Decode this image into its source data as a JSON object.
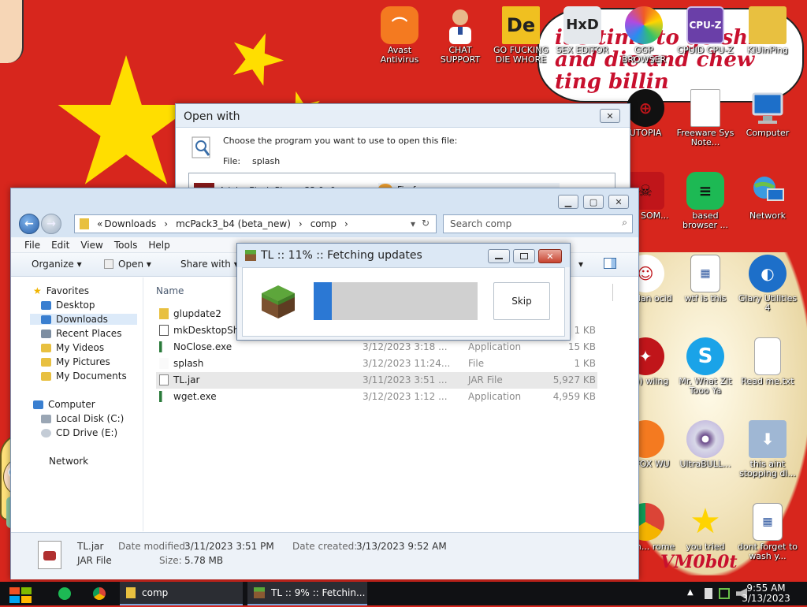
{
  "desktop": {
    "speech_text": "it's time to go shi and die and chew ting billin",
    "watermark": "VM0b0t",
    "icons": [
      {
        "name": "avast",
        "label": "Avast Antivirus",
        "color": "#f47a20"
      },
      {
        "name": "chat",
        "label": "CHAT SUPPORT",
        "color": "#d9b38c"
      },
      {
        "name": "de",
        "label": "GO FUCKING DIE WHORE",
        "color": "#f0c020"
      },
      {
        "name": "hxd",
        "label": "SEX EDITOR",
        "color": "#d0d8e0"
      },
      {
        "name": "browser",
        "label": "GGP BROWSER",
        "color": "#f05a28"
      },
      {
        "name": "cpuz",
        "label": "CPUID CPU-Z",
        "color": "#6a3fa8"
      },
      {
        "name": "kiuinping",
        "label": "KiUinPing",
        "color": "#e8c040"
      },
      {
        "name": "utopia",
        "label": "UTOPIA",
        "color": "#111111"
      },
      {
        "name": "freeware",
        "label": "Freeware Sys Note...",
        "color": "#ffffff"
      },
      {
        "name": "computer",
        "label": "Computer",
        "color": "#3a8fd8"
      },
      {
        "name": "tya",
        "label": "TYA SOM...",
        "color": "#c0151a"
      },
      {
        "name": "based",
        "label": "based browser ...",
        "color": "#1db954"
      },
      {
        "name": "network",
        "label": "Network",
        "color": "#3a8fd8"
      },
      {
        "name": "dandan",
        "label": "dandan ocid",
        "color": "#ffffff"
      },
      {
        "name": "wtf",
        "label": "wtf is this",
        "color": "#ffffff"
      },
      {
        "name": "glary",
        "label": "Glary Utilities 4",
        "color": "#1d6fc9"
      },
      {
        "name": "rey",
        "label": "rey)) wling",
        "color": "#c0151a"
      },
      {
        "name": "skype",
        "label": "Mr. What Zit Tooo Ya",
        "color": "#1aa3e8"
      },
      {
        "name": "readme",
        "label": "Read me.txt",
        "color": "#ffffff"
      },
      {
        "name": "foxwu",
        "label": "RY FOX WU",
        "color": "#f47a20"
      },
      {
        "name": "ultrabull",
        "label": "UltraBULL...",
        "color": "#d8d8e8"
      },
      {
        "name": "aint",
        "label": "this aint stopping di...",
        "color": "#9fb7d4"
      },
      {
        "name": "chrome",
        "label": "mmm... rome",
        "color": "#1a9e55"
      },
      {
        "name": "youtried",
        "label": "you tried",
        "color": "#ffd400"
      },
      {
        "name": "dontforget",
        "label": "dont forget to wash y...",
        "color": "#ffffff"
      }
    ]
  },
  "open_with": {
    "title": "Open with",
    "close_symbol": "✕",
    "prompt": "Choose the program you want to use to open this file:",
    "file_label": "File:",
    "file_name": "splash",
    "programs": [
      "Adobe Flash Player 32.0 r0",
      "Firefox"
    ]
  },
  "explorer": {
    "caption": {
      "min": "▁",
      "max": "▢",
      "close": "✕"
    },
    "breadcrumb": [
      "«",
      "Downloads",
      "›",
      "mcPack3_b4 (beta_new)",
      "›",
      "comp",
      "›"
    ],
    "search_placeholder": "Search comp",
    "menu": [
      "File",
      "Edit",
      "View",
      "Tools",
      "Help"
    ],
    "toolbar": {
      "organize": "Organize ▾",
      "open": "Open ▾",
      "share": "Share with ▾",
      "more": "▾"
    },
    "nav": {
      "favorites": "Favorites",
      "favorites_items": [
        "Desktop",
        "Downloads",
        "Recent Places",
        "My Videos",
        "My Pictures",
        "My Documents"
      ],
      "computer": "Computer",
      "computer_items": [
        "Local Disk (C:)",
        "CD Drive (E:)"
      ],
      "network": "Network"
    },
    "columns": {
      "name": "Name"
    },
    "files": [
      {
        "name": "glupdate2",
        "date": "",
        "type": "",
        "size": "",
        "kind": "folder"
      },
      {
        "name": "mkDesktopShortcut",
        "date": "",
        "type": "",
        "size": "1 KB",
        "kind": "script"
      },
      {
        "name": "NoClose.exe",
        "date": "3/12/2023 3:18 ...",
        "type": "Application",
        "size": "15 KB",
        "kind": "exe"
      },
      {
        "name": "splash",
        "date": "3/12/2023 11:24...",
        "type": "File",
        "size": "1 KB",
        "kind": "file"
      },
      {
        "name": "TL.jar",
        "date": "3/11/2023 3:51 ...",
        "type": "JAR File",
        "size": "5,927 KB",
        "kind": "jar"
      },
      {
        "name": "wget.exe",
        "date": "3/12/2023 1:12 ...",
        "type": "Application",
        "size": "4,959 KB",
        "kind": "exe"
      }
    ],
    "details": {
      "name": "TL.jar",
      "type": "JAR File",
      "date_modified_label": "Date modified:",
      "date_modified": "3/11/2023 3:51 PM",
      "date_created_label": "Date created:",
      "date_created": "3/13/2023 9:52 AM",
      "size_label": "Size:",
      "size": "5.78 MB"
    }
  },
  "updater": {
    "title": "TL :: 11% :: Fetching updates",
    "progress": 0.11,
    "skip_label": "Skip",
    "progress_color": "#2b78d4"
  },
  "taskbar": {
    "task_folder": "comp",
    "task_updater": "TL :: 9% :: Fetchin...",
    "time": "9:55 AM",
    "date": "3/13/2023"
  }
}
